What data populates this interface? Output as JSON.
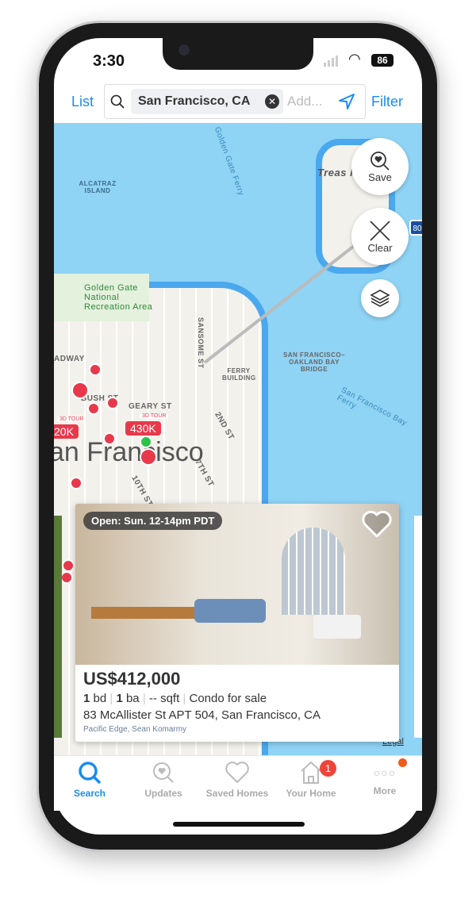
{
  "status": {
    "time": "3:30",
    "battery": "86"
  },
  "header": {
    "list": "List",
    "chip": "San Francisco, CA",
    "placeholder": "Add...",
    "filter": "Filter"
  },
  "map": {
    "labels": {
      "ferry": "Golden Gate Ferry",
      "alcatraz": "ALCATRAZ ISLAND",
      "treasure": "Treas Islan",
      "ggnra": "Golden Gate National Recreation Area",
      "sansome": "SANSOME ST",
      "ferry_building": "FERRY BUILDING",
      "bay_bridge": "SAN FRANCISCO–OAKLAND BAY BRIDGE",
      "bay_ferry": "San Francisco Bay Ferry",
      "broadway": "ADWAY",
      "bush": "BUSH ST",
      "geary": "GEARY ST",
      "second": "2ND ST",
      "seventh": "7TH ST",
      "tenth": "10TH ST",
      "city": "an Francisco",
      "legal": "Legal",
      "hwy": "80"
    },
    "pins": [
      {
        "price": "430K",
        "tag": "3D TOUR"
      },
      {
        "price": "20K",
        "tag": "3D TOUR"
      }
    ],
    "save": "Save",
    "clear": "Clear"
  },
  "listing": {
    "open": "Open: Sun. 12-14pm PDT",
    "price": "US$412,000",
    "beds": "1",
    "bd": "bd",
    "baths": "1",
    "ba": "ba",
    "sqft": "-- sqft",
    "type": "Condo for sale",
    "address": "83 McAllister St APT 504, San Francisco, CA",
    "agent": "Pacific Edge, Sean Komarmy"
  },
  "tabs": [
    {
      "label": "Search"
    },
    {
      "label": "Updates"
    },
    {
      "label": "Saved Homes"
    },
    {
      "label": "Your Home",
      "badge": "1"
    },
    {
      "label": "More"
    }
  ],
  "colors": {
    "accent": "#1a8cf0",
    "pin": "#e8394b",
    "badge": "#f04438"
  }
}
